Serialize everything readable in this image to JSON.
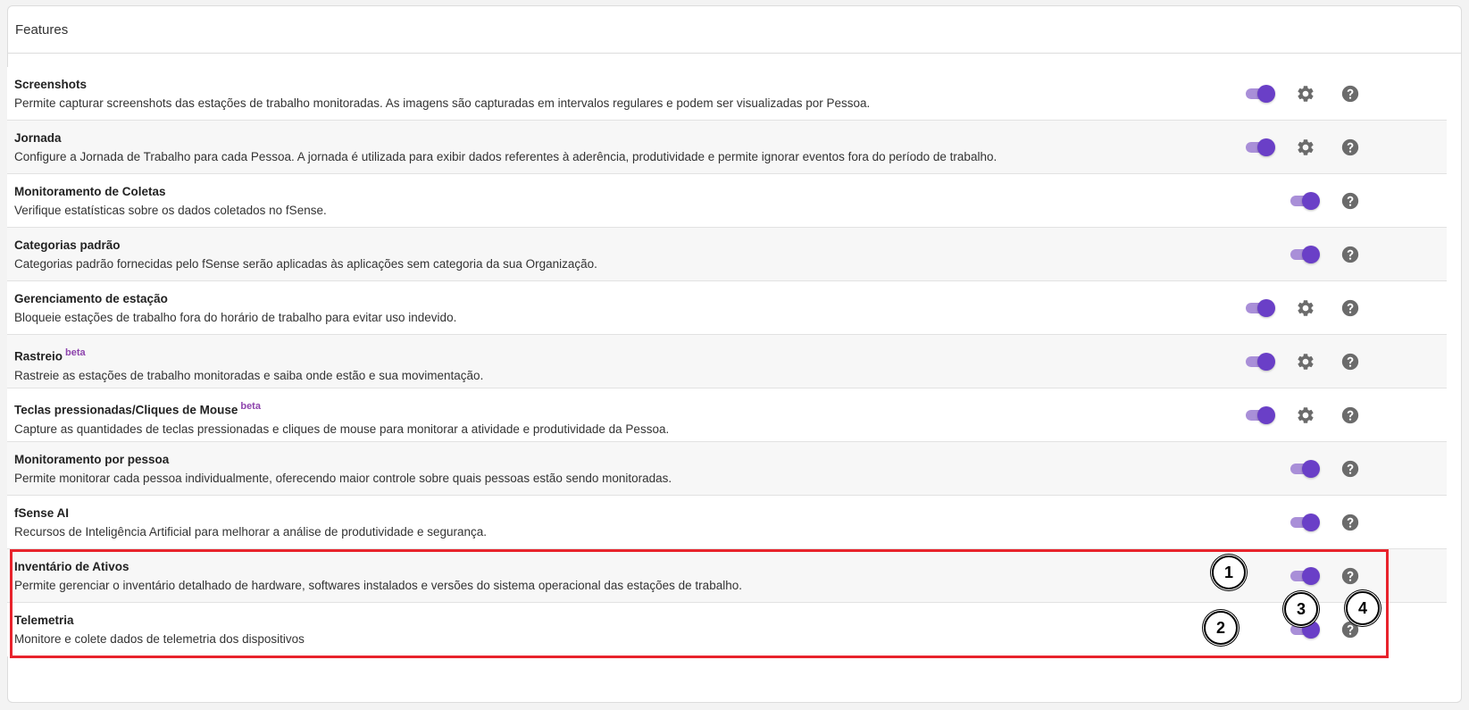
{
  "card": {
    "title": "Features"
  },
  "features": [
    {
      "title": "Screenshots",
      "beta": "",
      "description": "Permite capturar screenshots das estações de trabalho monitoradas. As imagens são capturadas em intervalos regulares e podem ser visualizadas por Pessoa.",
      "enabled": true,
      "has_settings": true
    },
    {
      "title": "Jornada",
      "beta": "",
      "description": "Configure a Jornada de Trabalho para cada Pessoa. A jornada é utilizada para exibir dados referentes à aderência, produtividade e permite ignorar eventos fora do período de trabalho.",
      "enabled": true,
      "has_settings": true
    },
    {
      "title": "Monitoramento de Coletas",
      "beta": "",
      "description": "Verifique estatísticas sobre os dados coletados no fSense.",
      "enabled": true,
      "has_settings": false
    },
    {
      "title": "Categorias padrão",
      "beta": "",
      "description": "Categorias padrão fornecidas pelo fSense serão aplicadas às aplicações sem categoria da sua Organização.",
      "enabled": true,
      "has_settings": false
    },
    {
      "title": "Gerenciamento de estação",
      "beta": "",
      "description": "Bloqueie estações de trabalho fora do horário de trabalho para evitar uso indevido.",
      "enabled": true,
      "has_settings": true
    },
    {
      "title": "Rastreio",
      "beta": "beta",
      "description": "Rastreie as estações de trabalho monitoradas e saiba onde estão e sua movimentação.",
      "enabled": true,
      "has_settings": true
    },
    {
      "title": "Teclas pressionadas/Cliques de Mouse",
      "beta": "beta",
      "description": "Capture as quantidades de teclas pressionadas e cliques de mouse para monitorar a atividade e produtividade da Pessoa.",
      "enabled": true,
      "has_settings": true
    },
    {
      "title": "Monitoramento por pessoa",
      "beta": "",
      "description": "Permite monitorar cada pessoa individualmente, oferecendo maior controle sobre quais pessoas estão sendo monitoradas.",
      "enabled": true,
      "has_settings": false
    },
    {
      "title": "fSense AI",
      "beta": "",
      "description": "Recursos de Inteligência Artificial para melhorar a análise de produtividade e segurança.",
      "enabled": true,
      "has_settings": false
    },
    {
      "title": "Inventário de Ativos",
      "beta": "",
      "description": "Permite gerenciar o inventário detalhado de hardware, softwares instalados e versões do sistema operacional das estações de trabalho.",
      "enabled": true,
      "has_settings": false
    },
    {
      "title": "Telemetria",
      "beta": "",
      "description": "Monitore e colete dados de telemetria dos dispositivos",
      "enabled": true,
      "has_settings": false
    }
  ],
  "annotations": {
    "markers": [
      "1",
      "2",
      "3",
      "4"
    ],
    "highlight_color": "#e8232c"
  },
  "colors": {
    "toggle_knob": "#6a3fc7",
    "toggle_track": "#a98fd8",
    "icon": "#6b6b6b",
    "beta": "#8e44ad"
  },
  "icons": {
    "toggle": "toggle-switch",
    "settings": "gear-icon",
    "help": "help-circle-icon"
  }
}
